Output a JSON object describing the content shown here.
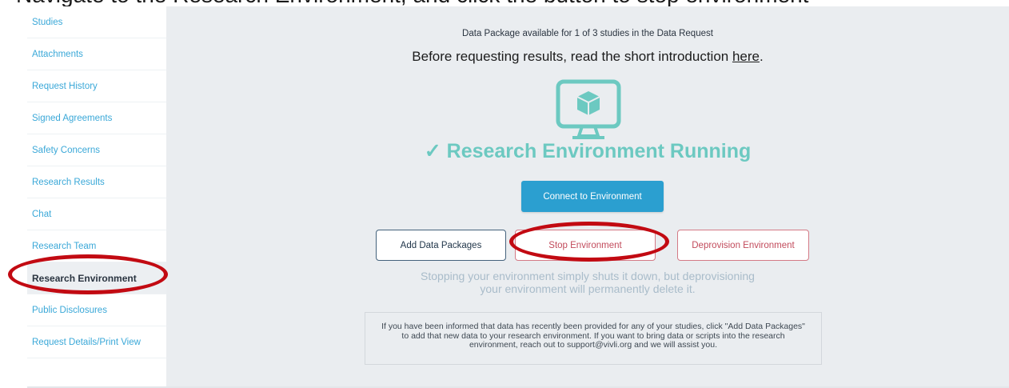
{
  "caption": "Navigate to the Research Environment, and click the button to stop environment",
  "sidebar": {
    "items": [
      {
        "label": "Studies"
      },
      {
        "label": "Attachments"
      },
      {
        "label": "Request History"
      },
      {
        "label": "Signed Agreements"
      },
      {
        "label": "Safety Concerns"
      },
      {
        "label": "Research Results"
      },
      {
        "label": "Chat"
      },
      {
        "label": "Research Team"
      },
      {
        "label": "Research Environment"
      },
      {
        "label": "Public Disclosures"
      },
      {
        "label": "Request Details/Print View"
      }
    ],
    "active_index": 8
  },
  "main": {
    "availability_text": "Data Package available for 1 of 3 studies in the Data Request",
    "intro_text": "Before requesting results, read the short introduction ",
    "intro_link": "here",
    "intro_end": ".",
    "monitor_icon": "monitor-cube-icon",
    "status_check_icon": "✓",
    "status_text": "Research Environment Running",
    "status_color": "#6cc9c1",
    "buttons": {
      "connect": "Connect to Environment",
      "add_packages": "Add Data Packages",
      "stop": "Stop Environment",
      "deprovision": "Deprovision Environment"
    },
    "helper_line1": "Stopping your environment simply shuts it down, but deprovisioning",
    "helper_line2": "your environment will permanently delete it.",
    "info_text": "If you have been informed that data has recently been provided for any of your studies, click \"Add Data Packages\" to add that new data to your research environment. If you want to bring data or scripts into the research environment, reach out to support@vivli.org and we will assist you."
  },
  "colors": {
    "accent_blue": "#2b9fd0",
    "teal": "#6cc9c1",
    "danger": "#c24b5c",
    "annotation_red": "#c20a12",
    "sidebar_link": "#3aa8d8"
  }
}
